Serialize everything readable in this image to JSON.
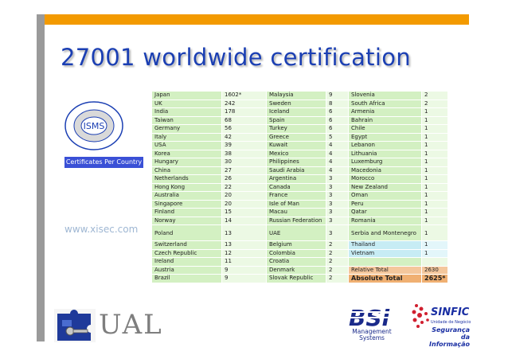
{
  "title": "27001 worldwide certification",
  "isms_logo": {
    "text": "ISMS",
    "ring_text": "International User Group"
  },
  "badge": "Certificates Per Country",
  "website": "www.xisec.com",
  "table": {
    "rows": [
      [
        "Japan",
        "1602*",
        "Malaysia",
        "9",
        "Slovenia",
        "2"
      ],
      [
        "UK",
        "242",
        "Sweden",
        "8",
        "South Africa",
        "2"
      ],
      [
        "India",
        "178",
        "Iceland",
        "6",
        "Armenia",
        "1"
      ],
      [
        "Taiwan",
        "68",
        "Spain",
        "6",
        "Bahrain",
        "1"
      ],
      [
        "Germany",
        "56",
        "Turkey",
        "6",
        "Chile",
        "1"
      ],
      [
        "Italy",
        "42",
        "Greece",
        "5",
        "Egypt",
        "1"
      ],
      [
        "USA",
        "39",
        "Kuwait",
        "4",
        "Lebanon",
        "1"
      ],
      [
        "Korea",
        "38",
        "Mexico",
        "4",
        "Lithuania",
        "1"
      ],
      [
        "Hungary",
        "30",
        "Philippines",
        "4",
        "Luxemburg",
        "1"
      ],
      [
        "China",
        "27",
        "Saudi Arabia",
        "4",
        "Macedonia",
        "1"
      ],
      [
        "Netherlands",
        "26",
        "Argentina",
        "3",
        "Morocco",
        "1"
      ],
      [
        "Hong Kong",
        "22",
        "Canada",
        "3",
        "New Zealand",
        "1"
      ],
      [
        "Australia",
        "20",
        "France",
        "3",
        "Oman",
        "1"
      ],
      [
        "Singapore",
        "20",
        "Isle of Man",
        "3",
        "Peru",
        "1"
      ],
      [
        "Finland",
        "15",
        "Macau",
        "3",
        "Qatar",
        "1"
      ],
      [
        "Norway",
        "14",
        "Russian Federation",
        "3",
        "Romania",
        "1"
      ],
      [
        "Poland",
        "13",
        "UAE",
        "3",
        "Serbia and Montenegro",
        "1"
      ],
      [
        "Switzerland",
        "13",
        "Belgium",
        "2",
        "Thailand",
        "1"
      ],
      [
        "Czech Republic",
        "12",
        "Colombia",
        "2",
        "Vietnam",
        "1"
      ],
      [
        "Ireland",
        "11",
        "Croatia",
        "2",
        "",
        ""
      ],
      [
        "Austria",
        "9",
        "Denmark",
        "2",
        "Relative Total",
        "2630"
      ],
      [
        "Brazil",
        "9",
        "Slovak Republic",
        "2",
        "Absolute Total",
        "2625*"
      ]
    ]
  },
  "logos": {
    "ual": "UAL",
    "bsi": "BSi",
    "bsi_sub": "Management Systems",
    "sinfic": "SINFIC",
    "sinfic_sub": "Unidade de Negócio",
    "sinfic_tag1": "Segurança",
    "sinfic_tag2": "da Informação"
  },
  "colors": {
    "accent_bar": "#f39a00",
    "side_bar": "#9a9a9a",
    "title": "#1b3fb3",
    "cell_green": "#d3f0c2",
    "cell_blue": "#c7ecf4",
    "cell_total": "#f0b072"
  }
}
